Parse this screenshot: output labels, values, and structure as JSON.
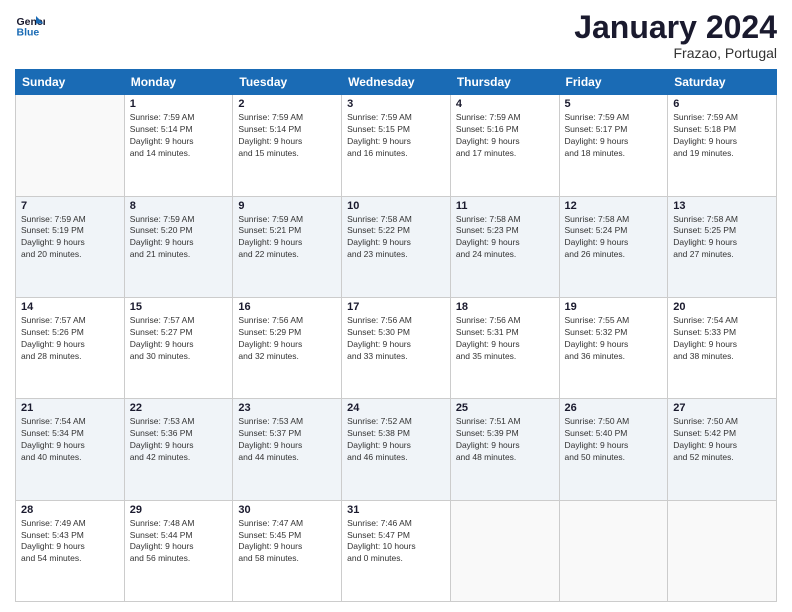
{
  "header": {
    "title": "January 2024",
    "location": "Frazao, Portugal"
  },
  "columns": [
    "Sunday",
    "Monday",
    "Tuesday",
    "Wednesday",
    "Thursday",
    "Friday",
    "Saturday"
  ],
  "weeks": [
    [
      {
        "day": "",
        "info": ""
      },
      {
        "day": "1",
        "info": "Sunrise: 7:59 AM\nSunset: 5:14 PM\nDaylight: 9 hours\nand 14 minutes."
      },
      {
        "day": "2",
        "info": "Sunrise: 7:59 AM\nSunset: 5:14 PM\nDaylight: 9 hours\nand 15 minutes."
      },
      {
        "day": "3",
        "info": "Sunrise: 7:59 AM\nSunset: 5:15 PM\nDaylight: 9 hours\nand 16 minutes."
      },
      {
        "day": "4",
        "info": "Sunrise: 7:59 AM\nSunset: 5:16 PM\nDaylight: 9 hours\nand 17 minutes."
      },
      {
        "day": "5",
        "info": "Sunrise: 7:59 AM\nSunset: 5:17 PM\nDaylight: 9 hours\nand 18 minutes."
      },
      {
        "day": "6",
        "info": "Sunrise: 7:59 AM\nSunset: 5:18 PM\nDaylight: 9 hours\nand 19 minutes."
      }
    ],
    [
      {
        "day": "7",
        "info": "Sunrise: 7:59 AM\nSunset: 5:19 PM\nDaylight: 9 hours\nand 20 minutes."
      },
      {
        "day": "8",
        "info": "Sunrise: 7:59 AM\nSunset: 5:20 PM\nDaylight: 9 hours\nand 21 minutes."
      },
      {
        "day": "9",
        "info": "Sunrise: 7:59 AM\nSunset: 5:21 PM\nDaylight: 9 hours\nand 22 minutes."
      },
      {
        "day": "10",
        "info": "Sunrise: 7:58 AM\nSunset: 5:22 PM\nDaylight: 9 hours\nand 23 minutes."
      },
      {
        "day": "11",
        "info": "Sunrise: 7:58 AM\nSunset: 5:23 PM\nDaylight: 9 hours\nand 24 minutes."
      },
      {
        "day": "12",
        "info": "Sunrise: 7:58 AM\nSunset: 5:24 PM\nDaylight: 9 hours\nand 26 minutes."
      },
      {
        "day": "13",
        "info": "Sunrise: 7:58 AM\nSunset: 5:25 PM\nDaylight: 9 hours\nand 27 minutes."
      }
    ],
    [
      {
        "day": "14",
        "info": "Sunrise: 7:57 AM\nSunset: 5:26 PM\nDaylight: 9 hours\nand 28 minutes."
      },
      {
        "day": "15",
        "info": "Sunrise: 7:57 AM\nSunset: 5:27 PM\nDaylight: 9 hours\nand 30 minutes."
      },
      {
        "day": "16",
        "info": "Sunrise: 7:56 AM\nSunset: 5:29 PM\nDaylight: 9 hours\nand 32 minutes."
      },
      {
        "day": "17",
        "info": "Sunrise: 7:56 AM\nSunset: 5:30 PM\nDaylight: 9 hours\nand 33 minutes."
      },
      {
        "day": "18",
        "info": "Sunrise: 7:56 AM\nSunset: 5:31 PM\nDaylight: 9 hours\nand 35 minutes."
      },
      {
        "day": "19",
        "info": "Sunrise: 7:55 AM\nSunset: 5:32 PM\nDaylight: 9 hours\nand 36 minutes."
      },
      {
        "day": "20",
        "info": "Sunrise: 7:54 AM\nSunset: 5:33 PM\nDaylight: 9 hours\nand 38 minutes."
      }
    ],
    [
      {
        "day": "21",
        "info": "Sunrise: 7:54 AM\nSunset: 5:34 PM\nDaylight: 9 hours\nand 40 minutes."
      },
      {
        "day": "22",
        "info": "Sunrise: 7:53 AM\nSunset: 5:36 PM\nDaylight: 9 hours\nand 42 minutes."
      },
      {
        "day": "23",
        "info": "Sunrise: 7:53 AM\nSunset: 5:37 PM\nDaylight: 9 hours\nand 44 minutes."
      },
      {
        "day": "24",
        "info": "Sunrise: 7:52 AM\nSunset: 5:38 PM\nDaylight: 9 hours\nand 46 minutes."
      },
      {
        "day": "25",
        "info": "Sunrise: 7:51 AM\nSunset: 5:39 PM\nDaylight: 9 hours\nand 48 minutes."
      },
      {
        "day": "26",
        "info": "Sunrise: 7:50 AM\nSunset: 5:40 PM\nDaylight: 9 hours\nand 50 minutes."
      },
      {
        "day": "27",
        "info": "Sunrise: 7:50 AM\nSunset: 5:42 PM\nDaylight: 9 hours\nand 52 minutes."
      }
    ],
    [
      {
        "day": "28",
        "info": "Sunrise: 7:49 AM\nSunset: 5:43 PM\nDaylight: 9 hours\nand 54 minutes."
      },
      {
        "day": "29",
        "info": "Sunrise: 7:48 AM\nSunset: 5:44 PM\nDaylight: 9 hours\nand 56 minutes."
      },
      {
        "day": "30",
        "info": "Sunrise: 7:47 AM\nSunset: 5:45 PM\nDaylight: 9 hours\nand 58 minutes."
      },
      {
        "day": "31",
        "info": "Sunrise: 7:46 AM\nSunset: 5:47 PM\nDaylight: 10 hours\nand 0 minutes."
      },
      {
        "day": "",
        "info": ""
      },
      {
        "day": "",
        "info": ""
      },
      {
        "day": "",
        "info": ""
      }
    ]
  ]
}
